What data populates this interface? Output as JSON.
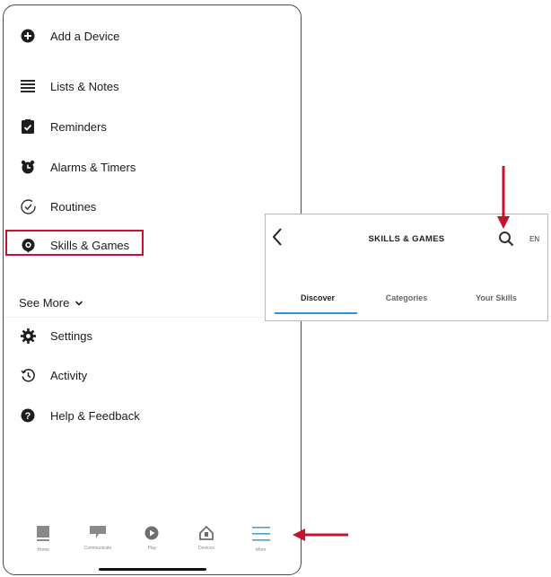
{
  "menu": {
    "items": [
      {
        "label": "Add a Device",
        "icon": "plus-circle-icon"
      },
      {
        "label": "Lists & Notes",
        "icon": "list-icon"
      },
      {
        "label": "Reminders",
        "icon": "reminder-clipboard-icon"
      },
      {
        "label": "Alarms & Timers",
        "icon": "alarm-clock-icon"
      },
      {
        "label": "Routines",
        "icon": "routine-check-icon"
      },
      {
        "label": "Skills & Games",
        "icon": "skills-bubble-icon"
      },
      {
        "label": "Settings",
        "icon": "gear-icon"
      },
      {
        "label": "Activity",
        "icon": "history-clock-icon"
      },
      {
        "label": "Help & Feedback",
        "icon": "question-circle-icon"
      }
    ],
    "see_more": "See More"
  },
  "tabbar": {
    "tabs": [
      {
        "label": "Home",
        "icon": "home-device-icon"
      },
      {
        "label": "Communicate",
        "icon": "chat-icon"
      },
      {
        "label": "Play",
        "icon": "play-icon"
      },
      {
        "label": "Devices",
        "icon": "devices-icon"
      },
      {
        "label": "More",
        "icon": "menu-lines-icon"
      }
    ]
  },
  "skills": {
    "title": "SKILLS & GAMES",
    "lang": "EN",
    "tabs": [
      {
        "label": "Discover"
      },
      {
        "label": "Categories"
      },
      {
        "label": "Your Skills"
      }
    ]
  },
  "colors": {
    "accent_red": "#c4122f",
    "tab_underline": "#2f93d7"
  }
}
